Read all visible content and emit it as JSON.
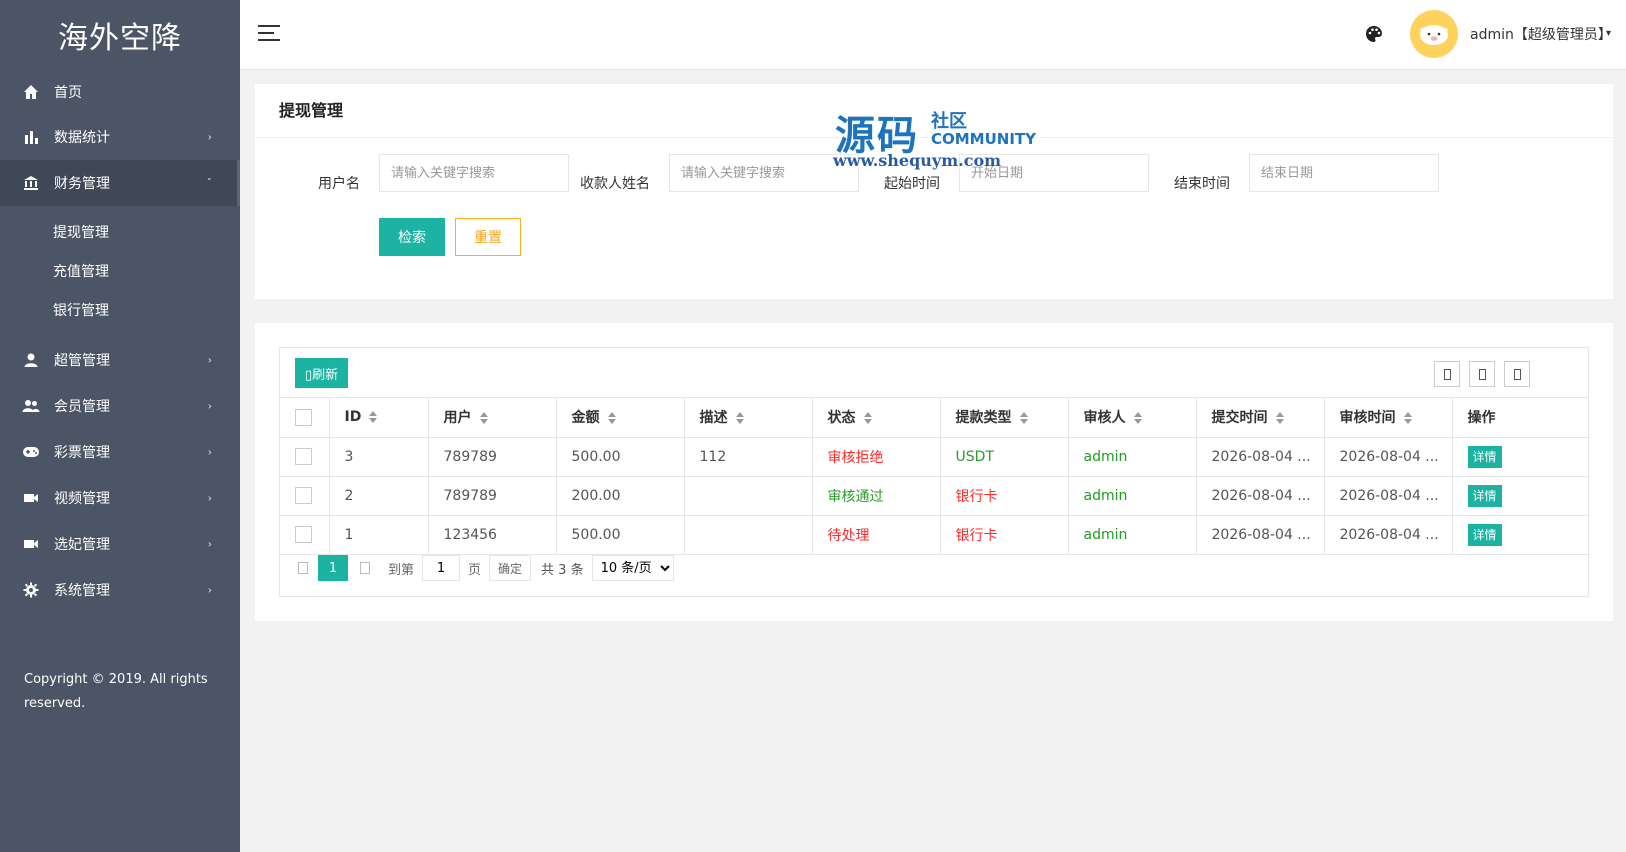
{
  "brand": "海外空降",
  "sidebar": {
    "items": [
      {
        "label": "首页",
        "icon": "home-icon"
      },
      {
        "label": "数据统计",
        "icon": "bar-chart-icon"
      },
      {
        "label": "财务管理",
        "icon": "bank-icon"
      },
      {
        "label": "超管管理",
        "icon": "user-icon"
      },
      {
        "label": "会员管理",
        "icon": "users-icon"
      },
      {
        "label": "彩票管理",
        "icon": "gamepad-icon"
      },
      {
        "label": "视频管理",
        "icon": "video-icon"
      },
      {
        "label": "选妃管理",
        "icon": "video-icon"
      },
      {
        "label": "系统管理",
        "icon": "gear-icon"
      }
    ],
    "sub_items": [
      "提现管理",
      "充值管理",
      "银行管理"
    ],
    "chevron_right": "›",
    "chevron_down": "ˇ"
  },
  "copyright": "Copyright © 2019. All rights reserved.",
  "header": {
    "user": "admin【超级管理员】",
    "caret": "▾"
  },
  "filter": {
    "title": "提现管理",
    "username_label": "用户名",
    "username_placeholder": "请输入关键字搜索",
    "payee_label": "收款人姓名",
    "payee_placeholder": "请输入关键字搜索",
    "start_label": "起始时间",
    "start_placeholder": "开始日期",
    "end_label": "结束时间",
    "end_placeholder": "结束日期",
    "search_button": "检索",
    "reset_button": "重置"
  },
  "watermark": {
    "big": "源码",
    "cn": "社区",
    "en": "COMMUNITY",
    "url": "www.shequym.com"
  },
  "table": {
    "refresh_label": "刷新",
    "refresh_icon": "▯",
    "columns": [
      "ID",
      "用户",
      "金额",
      "描述",
      "状态",
      "提款类型",
      "审核人",
      "提交时间",
      "审核时间",
      "操作"
    ],
    "rows": [
      {
        "id": "3",
        "user": "789789",
        "amount": "500.00",
        "desc": "112",
        "status": "审核拒绝",
        "type": "USDT",
        "reviewer": "admin",
        "submit_time": "2026-08-04 ...",
        "review_time": "2026-08-04 ...",
        "action": "详情"
      },
      {
        "id": "2",
        "user": "789789",
        "amount": "200.00",
        "desc": "",
        "status": "审核通过",
        "type": "银行卡",
        "reviewer": "admin",
        "submit_time": "2026-08-04 ...",
        "review_time": "2026-08-04 ...",
        "action": "详情"
      },
      {
        "id": "1",
        "user": "123456",
        "amount": "500.00",
        "desc": "",
        "status": "待处理",
        "type": "银行卡",
        "reviewer": "admin",
        "submit_time": "2026-08-04 ...",
        "review_time": "2026-08-04 ...",
        "action": "详情"
      }
    ]
  },
  "pager": {
    "current": "1",
    "goto_label": "到第",
    "page_value": "1",
    "page_unit": "页",
    "confirm": "确定",
    "total": "共 3 条",
    "page_size": "10 条/页"
  },
  "colors": {
    "sidebar_bg": "#4b5565",
    "accent": "#1cb3a3",
    "reset_border": "#f5b025",
    "status_red": "#ff2b2b",
    "status_green": "#2d9a2d"
  }
}
